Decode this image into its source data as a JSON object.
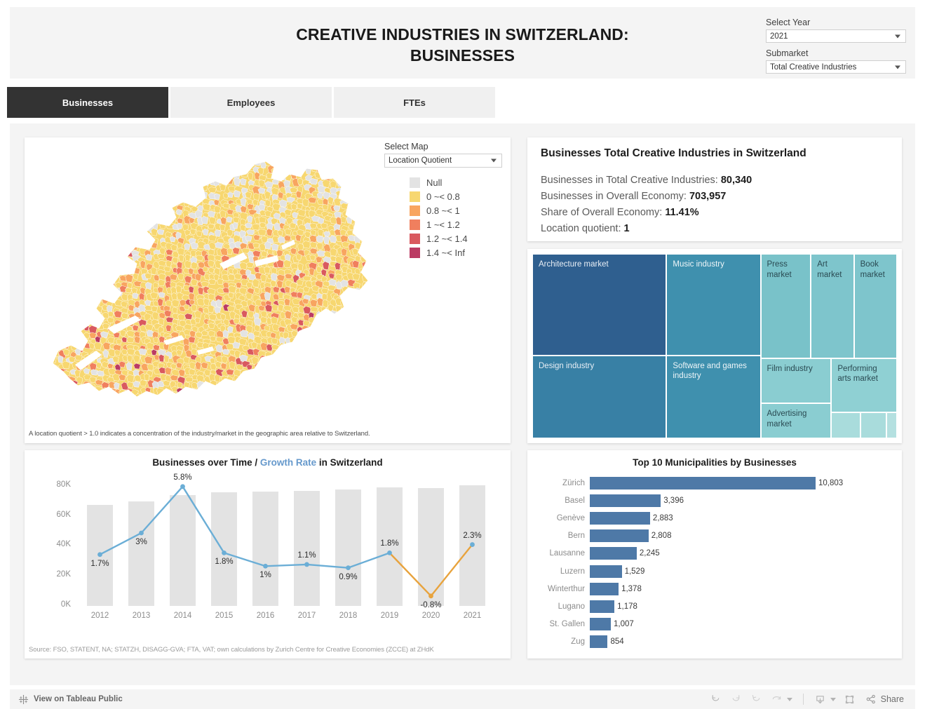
{
  "header": {
    "title": "CREATIVE INDUSTRIES IN SWITZERLAND:\nBUSINESSES",
    "filters": {
      "year_label": "Select Year",
      "year_value": "2021",
      "submarket_label": "Submarket",
      "submarket_value": "Total Creative Industries"
    }
  },
  "tabs": [
    {
      "label": "Businesses",
      "active": true
    },
    {
      "label": "Employees",
      "active": false
    },
    {
      "label": "FTEs",
      "active": false
    }
  ],
  "map": {
    "select_label": "Select Map",
    "select_value": "Location Quotient",
    "legend": [
      {
        "label": "Null",
        "color": "#e3e3e3"
      },
      {
        "label": "0 ~< 0.8",
        "color": "#f7d770"
      },
      {
        "label": "0.8 ~< 1",
        "color": "#f8a560"
      },
      {
        "label": "1 ~< 1.2",
        "color": "#f07f5e"
      },
      {
        "label": "1.2 ~< 1.4",
        "color": "#d9595f"
      },
      {
        "label": "1.4 ~< Inf",
        "color": "#bb3b63"
      }
    ],
    "note": "A location quotient > 1.0 indicates a concentration of the industry/market in the geographic area relative to Switzerland."
  },
  "kpi": {
    "title": "Businesses Total Creative Industries in Switzerland",
    "rows": [
      {
        "label": "Businesses in Total Creative Industries:",
        "value": "80,340"
      },
      {
        "label": "Businesses in Overall Economy:",
        "value": "703,957"
      },
      {
        "label": "Share of Overall Economy:",
        "value": "11.41%"
      },
      {
        "label": "Location quotient:",
        "value": "1"
      }
    ]
  },
  "chart_data": [
    {
      "type": "treemap",
      "title": "",
      "tiles": [
        {
          "label": "Architecture market",
          "color": "#2f5f8f",
          "text": "#e8eef5",
          "x": 0,
          "y": 0,
          "w": 36.8,
          "h": 55.0
        },
        {
          "label": "Design industry",
          "color": "#3880a5",
          "text": "#e8eef5",
          "x": 0,
          "y": 55.0,
          "w": 36.8,
          "h": 45.0
        },
        {
          "label": "Music industry",
          "color": "#3f90ae",
          "text": "#eef5f8",
          "x": 36.8,
          "y": 0,
          "w": 25.8,
          "h": 55.0
        },
        {
          "label": "Software and games\nindustry",
          "color": "#3f90ae",
          "text": "#eef5f8",
          "x": 36.8,
          "y": 55.0,
          "w": 25.8,
          "h": 45.0
        },
        {
          "label": "Press\nmarket",
          "color": "#79c2c9",
          "text": "#2a4a52",
          "x": 62.6,
          "y": 0,
          "w": 13.8,
          "h": 56.5
        },
        {
          "label": "Art\nmarket",
          "color": "#7ec5cc",
          "text": "#2a4a52",
          "x": 76.4,
          "y": 0,
          "w": 11.8,
          "h": 56.5
        },
        {
          "label": "Book\nmarket",
          "color": "#7ec5cc",
          "text": "#2a4a52",
          "x": 88.2,
          "y": 0,
          "w": 11.8,
          "h": 56.5
        },
        {
          "label": "Film industry",
          "color": "#8acdd1",
          "text": "#2a4a52",
          "x": 62.6,
          "y": 56.5,
          "w": 19.4,
          "h": 24.5
        },
        {
          "label": "Advertising\nmarket",
          "color": "#8acdd1",
          "text": "#2a4a52",
          "x": 62.6,
          "y": 81.0,
          "w": 19.4,
          "h": 19.0
        },
        {
          "label": "Performing\narts market",
          "color": "#8fd0d3",
          "text": "#2a4a52",
          "x": 82.0,
          "y": 56.5,
          "w": 18.0,
          "h": 29.5
        },
        {
          "label": "",
          "color": "#a9dcdc",
          "text": "#2a4a52",
          "x": 82.0,
          "y": 86.0,
          "w": 8.0,
          "h": 14.0
        },
        {
          "label": "",
          "color": "#a9dcdc",
          "text": "#2a4a52",
          "x": 90.0,
          "y": 86.0,
          "w": 7.2,
          "h": 14.0
        },
        {
          "label": "",
          "color": "#b4e0e0",
          "text": "#2a4a52",
          "x": 97.2,
          "y": 86.0,
          "w": 2.8,
          "h": 14.0
        }
      ]
    },
    {
      "type": "bar",
      "title": "Businesses over Time / Growth Rate in Switzerland",
      "title_parts": {
        "a": "Businesses over Time / ",
        "b": "Growth Rate",
        "c": " in Switzerland"
      },
      "categories": [
        "2012",
        "2013",
        "2014",
        "2015",
        "2016",
        "2017",
        "2018",
        "2019",
        "2020",
        "2021"
      ],
      "values": [
        67400,
        69600,
        73600,
        75500,
        76200,
        76800,
        77500,
        78900,
        78300,
        80340
      ],
      "ylabel": "",
      "xlabel": "",
      "ylim": [
        0,
        85000
      ],
      "yticks": [
        "0K",
        "20K",
        "40K",
        "60K",
        "80K"
      ],
      "ytick_values": [
        0,
        20000,
        40000,
        60000,
        80000
      ],
      "series": [
        {
          "name": "Growth Rate",
          "type": "line",
          "values": [
            1.7,
            3.0,
            5.8,
            1.8,
            1.0,
            1.1,
            0.9,
            1.8,
            -0.8,
            2.3
          ],
          "labels": [
            "1.7%",
            "3%",
            "5.8%",
            "1.8%",
            "1%",
            "1.1%",
            "0.9%",
            "1.8%",
            "-0.8%",
            "2.3%"
          ],
          "color_positive": "#6baed6",
          "color_negative": "#e8a33d"
        }
      ],
      "bar_color": "#e3e3e3",
      "source": "Source: FSO, STATENT, NA; STATZH, DISAGG-GVA; FTA, VAT; own calculations by Zurich Centre for Creative Economies (ZCCE) at ZHdK"
    },
    {
      "type": "bar",
      "orientation": "horizontal",
      "title": "Top 10 Municipalities by Businesses",
      "categories": [
        "Zürich",
        "Basel",
        "Genève",
        "Bern",
        "Lausanne",
        "Luzern",
        "Winterthur",
        "Lugano",
        "St. Gallen",
        "Zug"
      ],
      "values": [
        10803,
        3396,
        2883,
        2808,
        2245,
        1529,
        1378,
        1178,
        1007,
        854
      ],
      "labels": [
        "10,803",
        "3,396",
        "2,883",
        "2,808",
        "2,245",
        "1,529",
        "1,378",
        "1,178",
        "1,007",
        "854"
      ],
      "bar_color": "#4e79a7",
      "xlim": [
        0,
        10803
      ]
    }
  ],
  "footer": {
    "view_label": "View on Tableau Public",
    "share_label": "Share",
    "buttons": [
      "undo-button",
      "redo-button",
      "revert-button",
      "refresh-button",
      "pause-button",
      "download-button",
      "fullscreen-button"
    ]
  }
}
